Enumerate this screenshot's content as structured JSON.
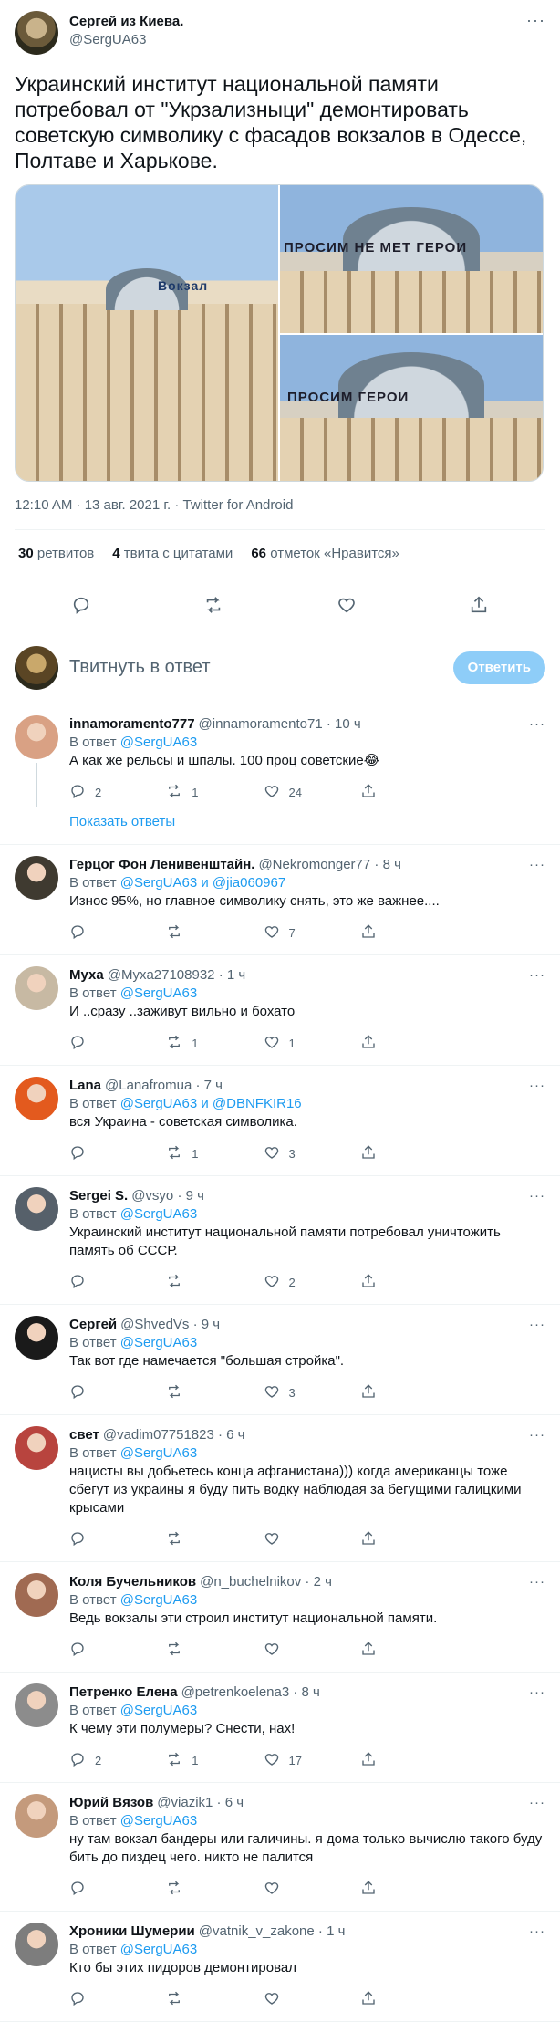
{
  "tweet": {
    "author_name": "Сергей из Киева.",
    "author_handle": "@SergUA63",
    "text": "Украинский институт национальной памяти потребовал от \"Укрзализныци\" демонтировать советскую символику с фасадов вокзалов в Одессе, Полтаве и Харькове.",
    "media": {
      "image1_sign": "Вокзал",
      "image2_sign": "ПРОСИМ НЕ МЕТ  ГЕРОИ",
      "image3_sign": "ПРОСИМ  ГЕРОИ"
    },
    "timestamp": "12:10 AM · 13 авг. 2021 г. · Twitter for Android",
    "stats": {
      "retweets_count": "30",
      "retweets_label": "ретвитов",
      "quotes_count": "4",
      "quotes_label": "твита с цитатами",
      "likes_count": "66",
      "likes_label": "отметок «Нравится»"
    }
  },
  "compose": {
    "placeholder": "Твитнуть в ответ",
    "button_label": "Ответить"
  },
  "replies": [
    {
      "name": "innamoramento777",
      "handle_time": "@innamoramento71 · 10 ч",
      "replying_prefix": "В ответ ",
      "replying_to": "@SergUA63",
      "text": "А как же рельсы и шпалы. 100 проц советские😂",
      "reply_count": "2",
      "retweet_count": "1",
      "like_count": "24",
      "show_replies": "Показать ответы",
      "avatar_color": "#d9a184"
    },
    {
      "name": "Герцог Фон Ленивенштайн.",
      "handle_time": "@Nekromonger77 · 8 ч",
      "replying_prefix": "В ответ ",
      "replying_to": "@SergUA63 и @jia060967",
      "text": "Износ 95%, но главное символику снять, это же важнее....",
      "reply_count": "",
      "retweet_count": "",
      "like_count": "7",
      "avatar_color": "#3f3a30"
    },
    {
      "name": "Муха",
      "handle_time": "@Myxa27108932 · 1 ч",
      "replying_prefix": "В ответ ",
      "replying_to": "@SergUA63",
      "text": "И ..сразу ..заживут  вильно и бохато",
      "reply_count": "",
      "retweet_count": "1",
      "like_count": "1",
      "avatar_color": "#c7b9a3"
    },
    {
      "name": "Lana",
      "handle_time": "@Lanafromua · 7 ч",
      "replying_prefix": "В ответ ",
      "replying_to": "@SergUA63 и @DBNFKIR16",
      "text": "вся Украина - советская символика.",
      "reply_count": "",
      "retweet_count": "1",
      "like_count": "3",
      "avatar_color": "#e35a1e"
    },
    {
      "name": "Sergei S.",
      "handle_time": "@vsyo · 9 ч",
      "replying_prefix": "В ответ ",
      "replying_to": "@SergUA63",
      "text": "Украинский институт национальной памяти потребовал уничтожить память об СССР.",
      "reply_count": "",
      "retweet_count": "",
      "like_count": "2",
      "avatar_color": "#56606a"
    },
    {
      "name": "Сергей",
      "handle_time": "@ShvedVs · 9 ч",
      "replying_prefix": "В ответ ",
      "replying_to": "@SergUA63",
      "text": "Так вот где намечается \"большая стройка\".",
      "reply_count": "",
      "retweet_count": "",
      "like_count": "3",
      "avatar_color": "#1a1a1a"
    },
    {
      "name": "свет",
      "handle_time": "@vadim07751823 · 6 ч",
      "replying_prefix": "В ответ ",
      "replying_to": "@SergUA63",
      "text": "нацисты вы добьетесь конца афганистана))) когда американцы тоже сбегут из украины я буду пить водку наблюдая за бегущими галицкими крысами",
      "reply_count": "",
      "retweet_count": "",
      "like_count": "",
      "avatar_color": "#b8443e"
    },
    {
      "name": "Коля Бучельников",
      "handle_time": "@n_buchelnikov · 2 ч",
      "replying_prefix": "В ответ ",
      "replying_to": "@SergUA63",
      "text": "Ведь вокзалы эти строил институт национальной памяти.",
      "reply_count": "",
      "retweet_count": "",
      "like_count": "",
      "avatar_color": "#a06a52"
    },
    {
      "name": "Петренко Елена",
      "handle_time": "@petrenkoelena3 · 8 ч",
      "replying_prefix": "В ответ ",
      "replying_to": "@SergUA63",
      "text": "К чему эти полумеры? Снести, нах!",
      "reply_count": "2",
      "retweet_count": "1",
      "like_count": "17",
      "avatar_color": "#8c8c8c"
    },
    {
      "name": "Юрий Вязов",
      "handle_time": "@viazik1 · 6 ч",
      "replying_prefix": "В ответ ",
      "replying_to": "@SergUA63",
      "text": "ну там вокзал бандеры или галичины. я дома только вычислю такого буду бить до пиздец чего. никто не палится",
      "reply_count": "",
      "retweet_count": "",
      "like_count": "",
      "avatar_color": "#c49a7c"
    },
    {
      "name": "Хроники Шумерии",
      "handle_time": "@vatnik_v_zakone · 1 ч",
      "replying_prefix": "В ответ ",
      "replying_to": "@SergUA63",
      "text": "Кто бы этих пидоров демонтировал",
      "reply_count": "",
      "retweet_count": "",
      "like_count": "",
      "avatar_color": "#7d7d7d"
    }
  ],
  "icons": {
    "more": "more-icon",
    "reply": "reply-icon",
    "retweet": "retweet-icon",
    "like": "like-icon",
    "share": "share-icon"
  },
  "colors": {
    "link": "#1d9bf0",
    "muted": "#536471",
    "reply_button": "#8ecdf8"
  }
}
